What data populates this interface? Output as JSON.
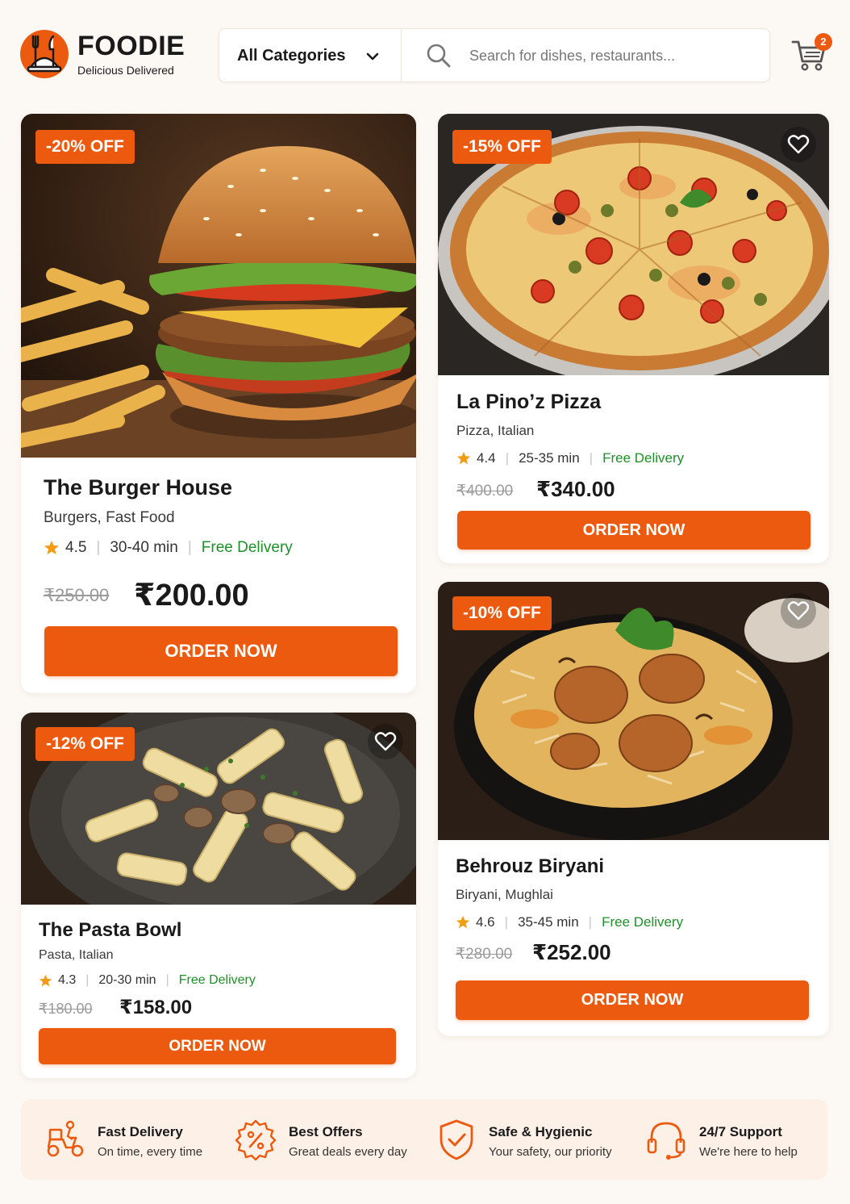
{
  "brand": {
    "name": "FOODIE",
    "tagline": "Delicious Delivered"
  },
  "search": {
    "category": "All Categories",
    "placeholder": "Search for dishes, restaurants..."
  },
  "cart": {
    "count": "2"
  },
  "colors": {
    "accent": "#ec5a0f",
    "free_delivery": "#1f8f2a",
    "background": "#fcf8f4"
  },
  "cards": [
    {
      "discount": "-20% OFF",
      "title": "The Burger House",
      "cuisine": "Burgers, Fast Food",
      "rating": "4.5",
      "time": "30-40 min",
      "delivery": "Free Delivery",
      "old_price": "₹250.00",
      "price": "₹200.00",
      "cta": "ORDER NOW",
      "favorite": false
    },
    {
      "discount": "-15% OFF",
      "title": "La Pino’z Pizza",
      "cuisine": "Pizza, Italian",
      "rating": "4.4",
      "time": "25-35 min",
      "delivery": "Free Delivery",
      "old_price": "₹400.00",
      "price": "₹340.00",
      "cta": "ORDER NOW",
      "favorite": true
    },
    {
      "discount": "-12% OFF",
      "title": "The Pasta Bowl",
      "cuisine": "Pasta, Italian",
      "rating": "4.3",
      "time": "20-30 min",
      "delivery": "Free Delivery",
      "old_price": "₹180.00",
      "price": "₹158.00",
      "cta": "ORDER NOW",
      "favorite": true
    },
    {
      "discount": "-10% OFF",
      "title": "Behrouz Biryani",
      "cuisine": "Biryani, Mughlai",
      "rating": "4.6",
      "time": "35-45 min",
      "delivery": "Free Delivery",
      "old_price": "₹280.00",
      "price": "₹252.00",
      "cta": "ORDER NOW",
      "favorite": true
    }
  ],
  "features": [
    {
      "icon": "scooter-icon",
      "title": "Fast Delivery",
      "subtitle": "On time, every time"
    },
    {
      "icon": "discount-badge-icon",
      "title": "Best Offers",
      "subtitle": "Great deals every day"
    },
    {
      "icon": "shield-check-icon",
      "title": "Safe & Hygienic",
      "subtitle": "Your safety, our priority"
    },
    {
      "icon": "headset-icon",
      "title": "24/7 Support",
      "subtitle": "We're here to help"
    }
  ]
}
